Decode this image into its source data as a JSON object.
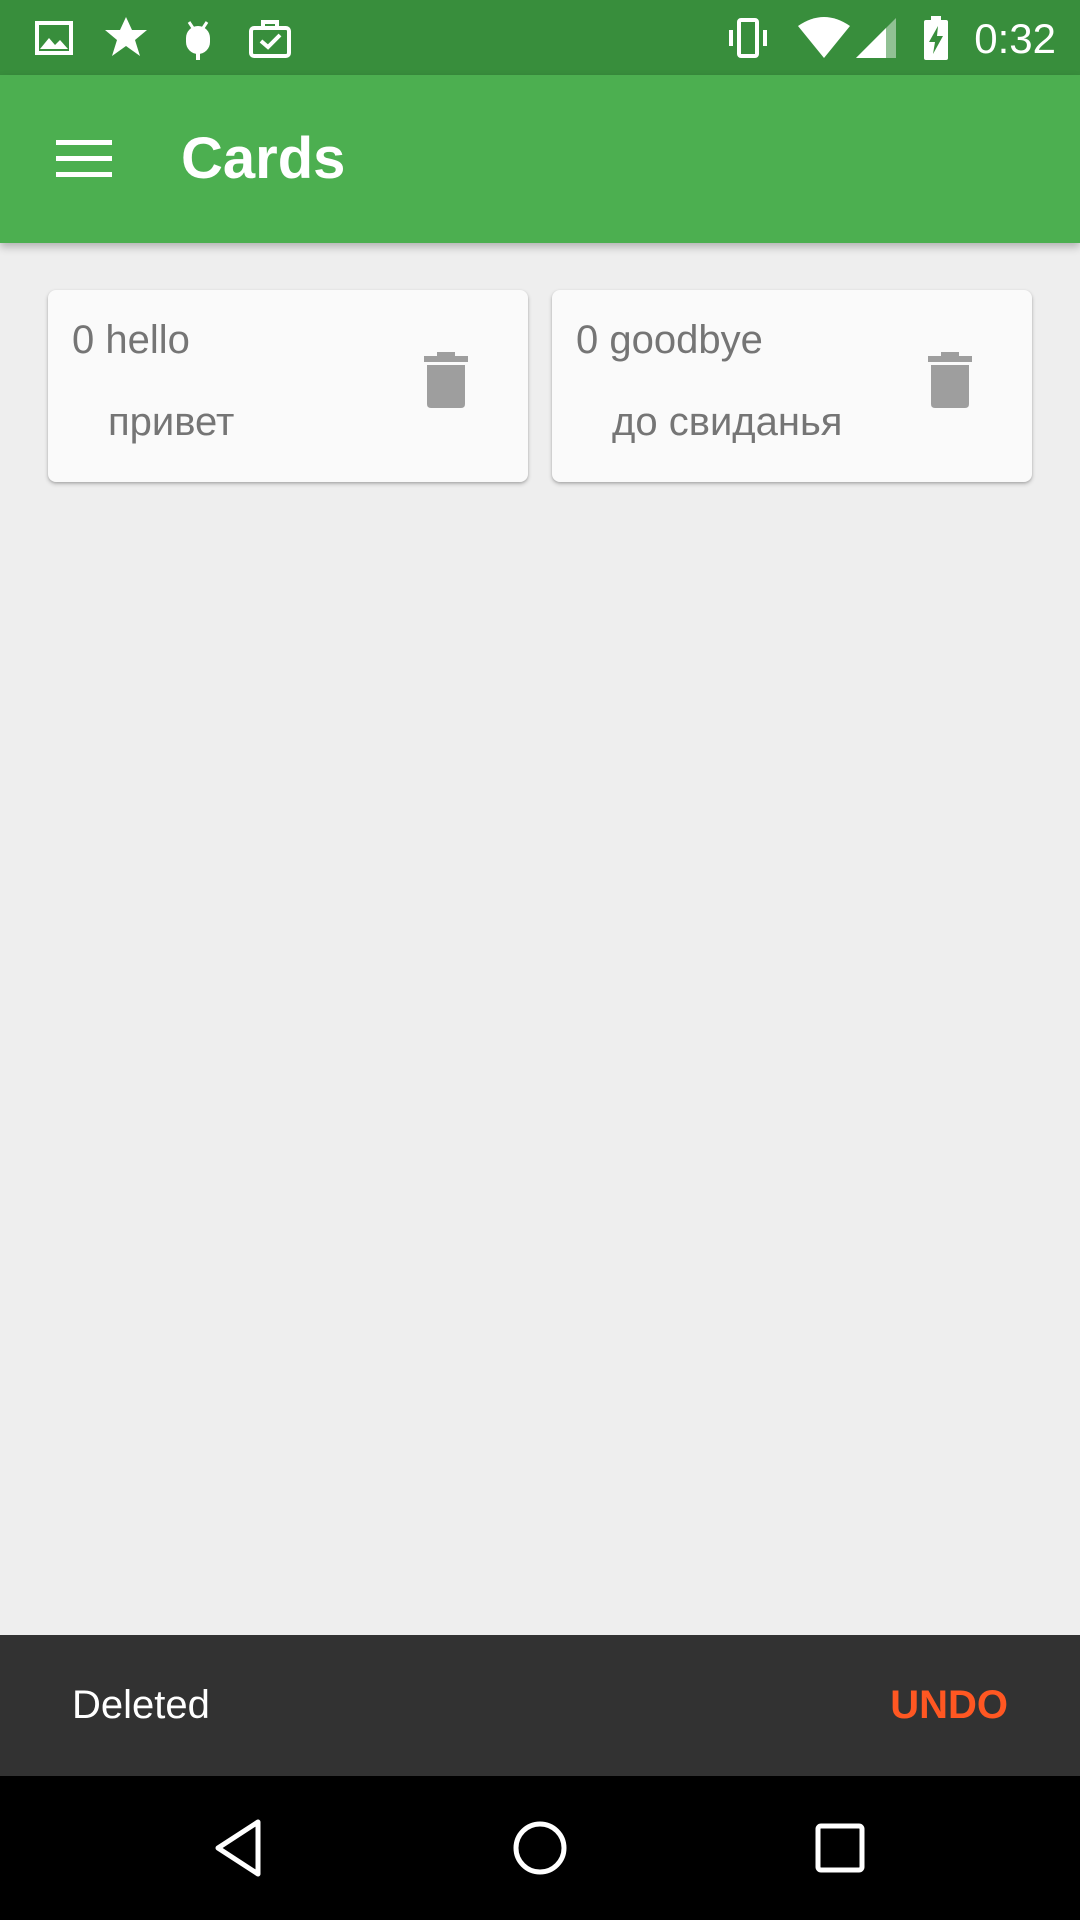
{
  "status_bar": {
    "time": "0:32",
    "icons": [
      "image-icon",
      "star-badge-icon",
      "android-debug-icon",
      "clipboard-check-icon",
      "vibrate-icon",
      "wifi-icon",
      "signal-icon",
      "battery-charging-icon"
    ]
  },
  "app_bar": {
    "title": "Cards",
    "menu_icon": "hamburger-menu-icon",
    "background": "#4CAF50"
  },
  "cards": [
    {
      "front": "0 hello",
      "back": "привет",
      "action_icon": "trash-icon"
    },
    {
      "front": "0 goodbye",
      "back": "до свиданья",
      "action_icon": "trash-icon"
    }
  ],
  "snackbar": {
    "message": "Deleted",
    "action": "UNDO",
    "action_color": "#FF5722"
  },
  "nav_bar": {
    "buttons": [
      "back-icon",
      "home-icon",
      "recents-icon"
    ]
  },
  "colors": {
    "status_bar": "#388E3C",
    "background": "#EEEEEE",
    "card": "#FAFAFA"
  }
}
